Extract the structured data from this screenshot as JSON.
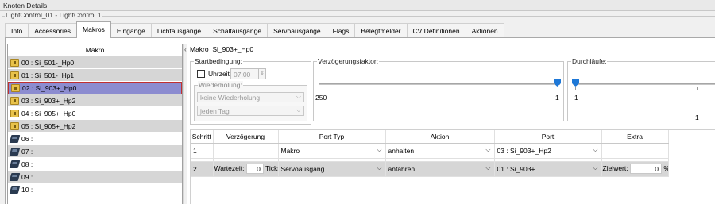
{
  "window": {
    "title": "Knoten Details"
  },
  "group": {
    "caption": "LightControl_01 - LightControl 1"
  },
  "tabs": [
    {
      "label": "Info"
    },
    {
      "label": "Accessories"
    },
    {
      "label": "Makros",
      "active": true
    },
    {
      "label": "Eingänge"
    },
    {
      "label": "Lichtausgänge"
    },
    {
      "label": "Schaltausgänge"
    },
    {
      "label": "Servoausgänge"
    },
    {
      "label": "Flags"
    },
    {
      "label": "Belegtmelder"
    },
    {
      "label": "CV Definitionen"
    },
    {
      "label": "Aktionen"
    }
  ],
  "makro_list": {
    "header": "Makro",
    "items": [
      {
        "label": "00 : Si_501-_Hp0",
        "icon": "folder-icon"
      },
      {
        "label": "01 : Si_501-_Hp1",
        "icon": "folder-icon"
      },
      {
        "label": "02 : Si_903+_Hp0",
        "icon": "folder-icon",
        "selected": true
      },
      {
        "label": "03 : Si_903+_Hp2",
        "icon": "folder-icon"
      },
      {
        "label": "04 : Si_905+_Hp0",
        "icon": "folder-icon"
      },
      {
        "label": "05 : Si_905+_Hp2",
        "icon": "folder-icon"
      },
      {
        "label": "06 :",
        "icon": "chip-icon"
      },
      {
        "label": "07 :",
        "icon": "chip-icon"
      },
      {
        "label": "08 :",
        "icon": "chip-icon"
      },
      {
        "label": "09 :",
        "icon": "chip-icon"
      },
      {
        "label": "10 :",
        "icon": "chip-icon"
      }
    ]
  },
  "detail": {
    "makro_label": "Makro",
    "makro_name": "Si_903+_Hp0",
    "startbedingung": {
      "caption": "Startbedingung:",
      "uhrzeit_label": "Uhrzeit:",
      "uhrzeit_checked": false,
      "uhrzeit_value": "07:00",
      "wiederholung_caption": "Wiederholung:",
      "wiederholung_value": "keine Wiederholung",
      "tag_value": "jeden Tag"
    },
    "verzoegerung": {
      "caption": "Verzögerungsfaktor:",
      "min_label": "250",
      "max_label": "1",
      "value": 1
    },
    "durchlaeufe": {
      "caption": "Durchläufe:",
      "min_label": "1",
      "max_label": "1",
      "value": 1
    }
  },
  "steps_table": {
    "headers": [
      "Schritt",
      "Verzögerung",
      "Port Typ",
      "Aktion",
      "Port",
      "Extra"
    ],
    "rows": [
      {
        "schritt": "1",
        "warte_label": "",
        "warte_value": "",
        "ticks_label": "",
        "port_typ": "Makro",
        "aktion": "anhalten",
        "port": "03 : Si_903+_Hp2",
        "ziel_label": "",
        "ziel_value": "",
        "ziel_unit": ""
      },
      {
        "schritt": "2",
        "warte_label": "Wartezeit:",
        "warte_value": "0",
        "ticks_label": "Ticks",
        "port_typ": "Servoausgang",
        "aktion": "anfahren",
        "port": "01 : Si_903+",
        "ziel_label": "Zielwert:",
        "ziel_value": "0",
        "ziel_unit": "%"
      }
    ]
  }
}
